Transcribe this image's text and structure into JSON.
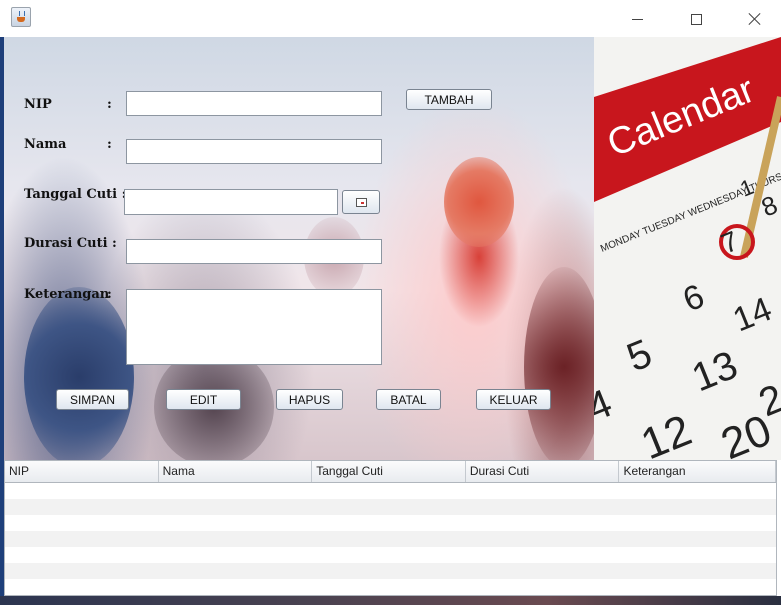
{
  "window": {
    "title": "",
    "icon": "java-cup-icon",
    "controls": [
      "minimize-icon",
      "maximize-icon",
      "close-icon"
    ]
  },
  "form": {
    "nip_label": "NIP",
    "nama_label": "Nama",
    "tanggal_label": "Tanggal Cuti :",
    "durasi_label": "Durasi Cuti",
    "keterangan_label": "Keterangan",
    "colon": ":",
    "nip_value": "",
    "nama_value": "",
    "tanggal_value": "",
    "durasi_value": "",
    "keterangan_value": "",
    "date_picker_icon": "calendar-icon"
  },
  "buttons": {
    "tambah": "TAMBAH",
    "simpan": "SIMPAN",
    "edit": "EDIT",
    "hapus": "HAPUS",
    "batal": "BATAL",
    "keluar": "KELUAR"
  },
  "calendar_image": {
    "title": "Calendar",
    "days": "MONDAY  TUESDAY  WEDNESDAY  THURSDAY  FRI",
    "numbers": [
      "1",
      "8",
      "7",
      "6",
      "14",
      "5",
      "13",
      "4",
      "12",
      "20",
      "2"
    ]
  },
  "table": {
    "columns": [
      "NIP",
      "Nama",
      "Tanggal Cuti",
      "Durasi Cuti",
      "Keterangan"
    ],
    "rows": []
  }
}
